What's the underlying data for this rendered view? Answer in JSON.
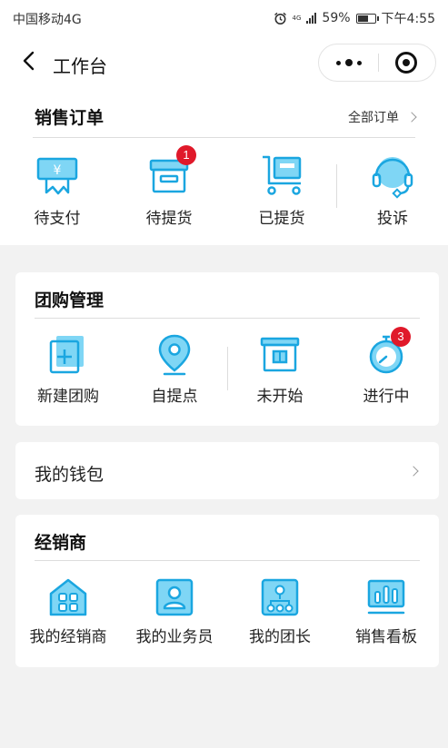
{
  "status_bar": {
    "carrier": "中国移动4G",
    "network": "4G",
    "battery": "59%",
    "time": "下午4:55"
  },
  "nav": {
    "title": "工作台"
  },
  "sales_orders": {
    "title": "销售订单",
    "all_orders_label": "全部订单",
    "items": [
      {
        "label": "待支付",
        "icon": "wallet-yen-icon"
      },
      {
        "label": "待提货",
        "icon": "box-icon",
        "badge": "1"
      },
      {
        "label": "已提货",
        "icon": "cart-icon"
      },
      {
        "label": "投诉",
        "icon": "headset-icon"
      }
    ]
  },
  "group_buy": {
    "title": "团购管理",
    "items": [
      {
        "label": "新建团购",
        "icon": "add-document-icon"
      },
      {
        "label": "自提点",
        "icon": "location-pin-icon"
      },
      {
        "label": "未开始",
        "icon": "archive-box-icon"
      },
      {
        "label": "进行中",
        "icon": "stopwatch-icon",
        "badge": "3"
      }
    ]
  },
  "wallet": {
    "label": "我的钱包"
  },
  "dealer": {
    "title": "经销商",
    "items": [
      {
        "label": "我的经销商",
        "icon": "store-icon"
      },
      {
        "label": "我的业务员",
        "icon": "user-icon"
      },
      {
        "label": "我的团长",
        "icon": "team-icon"
      },
      {
        "label": "销售看板",
        "icon": "dashboard-icon"
      }
    ]
  },
  "colors": {
    "accent": "#1aa6e0",
    "accent_light": "#7fd6f5",
    "badge": "#e0192a"
  }
}
